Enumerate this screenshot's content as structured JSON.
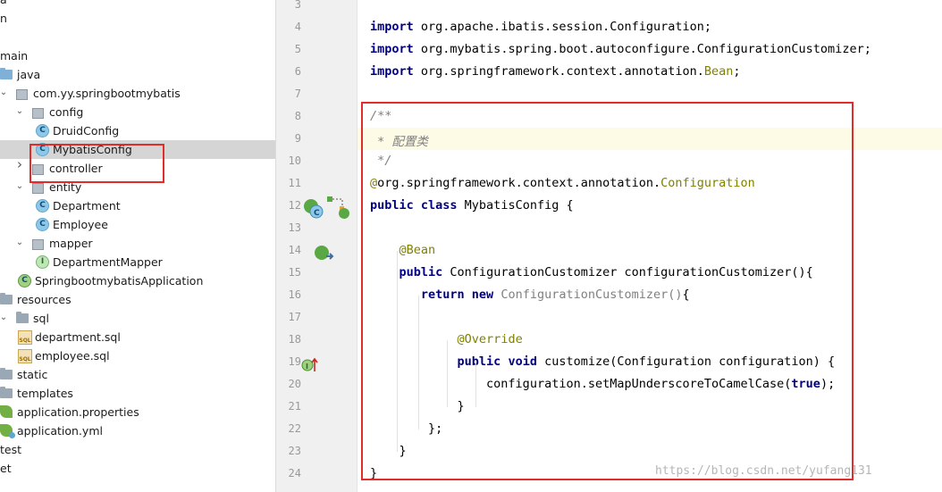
{
  "project_tree": {
    "items": [
      {
        "label": "a",
        "icon": "none",
        "arrow": "",
        "x": 0
      },
      {
        "label": "n",
        "icon": "none",
        "arrow": "",
        "x": 0
      },
      {
        "label": "",
        "icon": "none",
        "arrow": "",
        "x": 0
      },
      {
        "label": "main",
        "icon": "none",
        "arrow": "",
        "x": 0
      },
      {
        "label": "java",
        "icon": "folder-blue",
        "arrow": "",
        "x": 0
      },
      {
        "label": "com.yy.springbootmybatis",
        "icon": "package",
        "arrow": "down",
        "x": 0
      },
      {
        "label": "config",
        "icon": "package",
        "arrow": "down",
        "x": 18
      },
      {
        "label": "DruidConfig",
        "icon": "class",
        "arrow": "",
        "x": 40
      },
      {
        "label": "MybatisConfig",
        "icon": "class",
        "arrow": "",
        "x": 40,
        "selected": true
      },
      {
        "label": "controller",
        "icon": "package",
        "arrow": "right",
        "x": 18
      },
      {
        "label": "entity",
        "icon": "package",
        "arrow": "down",
        "x": 18
      },
      {
        "label": "Department",
        "icon": "class",
        "arrow": "",
        "x": 40
      },
      {
        "label": "Employee",
        "icon": "class",
        "arrow": "",
        "x": 40
      },
      {
        "label": "mapper",
        "icon": "package",
        "arrow": "down",
        "x": 18
      },
      {
        "label": "DepartmentMapper",
        "icon": "interface",
        "arrow": "",
        "x": 40
      },
      {
        "label": "SpringbootmybatisApplication",
        "icon": "spring-class",
        "arrow": "",
        "x": 20
      },
      {
        "label": "resources",
        "icon": "folder",
        "arrow": "",
        "x": 0
      },
      {
        "label": "sql",
        "icon": "folder",
        "arrow": "down",
        "x": 0
      },
      {
        "label": "department.sql",
        "icon": "sql-file",
        "arrow": "",
        "x": 20
      },
      {
        "label": "employee.sql",
        "icon": "sql-file",
        "arrow": "",
        "x": 20
      },
      {
        "label": "static",
        "icon": "folder",
        "arrow": "",
        "x": 0
      },
      {
        "label": "templates",
        "icon": "folder",
        "arrow": "",
        "x": 0
      },
      {
        "label": "application.properties",
        "icon": "spring-leaf",
        "arrow": "",
        "x": 0
      },
      {
        "label": "application.yml",
        "icon": "spring-leaf-app",
        "arrow": "",
        "x": 0
      },
      {
        "label": "test",
        "icon": "none",
        "arrow": "",
        "x": 0
      },
      {
        "label": "et",
        "icon": "none",
        "arrow": "",
        "x": 0
      }
    ]
  },
  "editor": {
    "first_line_number": 3,
    "current_line": 9,
    "lines": [
      {
        "n": "3",
        "tokens": []
      },
      {
        "n": "4",
        "tokens": [
          {
            "t": "import",
            "c": "kw"
          },
          {
            "t": " org.apache.ibatis.session.Configuration;",
            "c": ""
          }
        ]
      },
      {
        "n": "5",
        "tokens": [
          {
            "t": "import",
            "c": "kw"
          },
          {
            "t": " org.mybatis.spring.boot.autoconfigure.ConfigurationCustomizer;",
            "c": ""
          }
        ]
      },
      {
        "n": "6",
        "tokens": [
          {
            "t": "import",
            "c": "kw"
          },
          {
            "t": " org.springframework.context.annotation.",
            "c": ""
          },
          {
            "t": "Bean",
            "c": "an"
          },
          {
            "t": ";",
            "c": ""
          }
        ]
      },
      {
        "n": "7",
        "tokens": []
      },
      {
        "n": "8",
        "tokens": [
          {
            "t": "/**",
            "c": "cm"
          }
        ]
      },
      {
        "n": "9",
        "tokens": [
          {
            "t": " * 配置类",
            "c": "cm"
          }
        ]
      },
      {
        "n": "10",
        "tokens": [
          {
            "t": " */",
            "c": "cm"
          }
        ]
      },
      {
        "n": "11",
        "tokens": [
          {
            "t": "@",
            "c": "an"
          },
          {
            "t": "org.springframework.context.annotation.",
            "c": ""
          },
          {
            "t": "Configuration",
            "c": "an"
          }
        ]
      },
      {
        "n": "12",
        "tokens": [
          {
            "t": "public class",
            "c": "kw"
          },
          {
            "t": " MybatisConfig {",
            "c": ""
          }
        ]
      },
      {
        "n": "13",
        "tokens": []
      },
      {
        "n": "14",
        "tokens": [
          {
            "t": "    ",
            "c": ""
          },
          {
            "t": "@Bean",
            "c": "an"
          }
        ]
      },
      {
        "n": "15",
        "tokens": [
          {
            "t": "    ",
            "c": ""
          },
          {
            "t": "public",
            "c": "kw"
          },
          {
            "t": " ConfigurationCustomizer configurationCustomizer(){",
            "c": ""
          }
        ]
      },
      {
        "n": "16",
        "tokens": [
          {
            "t": "       ",
            "c": ""
          },
          {
            "t": "return new",
            "c": "kw"
          },
          {
            "t": " ConfigurationCustomizer()",
            "c": "tp"
          },
          {
            "t": "{",
            "c": ""
          }
        ]
      },
      {
        "n": "17",
        "tokens": []
      },
      {
        "n": "18",
        "tokens": [
          {
            "t": "            ",
            "c": ""
          },
          {
            "t": "@Override",
            "c": "an"
          }
        ]
      },
      {
        "n": "19",
        "tokens": [
          {
            "t": "            ",
            "c": ""
          },
          {
            "t": "public void",
            "c": "kw"
          },
          {
            "t": " customize(Configuration configuration) {",
            "c": ""
          }
        ]
      },
      {
        "n": "20",
        "tokens": [
          {
            "t": "                ",
            "c": ""
          },
          {
            "t": "configuration.setMapUnderscoreToCamelCase(",
            "c": ""
          },
          {
            "t": "true",
            "c": "kw"
          },
          {
            "t": ");",
            "c": ""
          }
        ]
      },
      {
        "n": "21",
        "tokens": [
          {
            "t": "            }",
            "c": ""
          }
        ]
      },
      {
        "n": "22",
        "tokens": [
          {
            "t": "        };",
            "c": ""
          }
        ]
      },
      {
        "n": "23",
        "tokens": [
          {
            "t": "    }",
            "c": ""
          }
        ]
      },
      {
        "n": "24",
        "tokens": [
          {
            "t": "}",
            "c": ""
          }
        ]
      }
    ]
  },
  "gutter_icons": {
    "line_12": [
      "spring-bean-class-icon",
      "spring-config-icon"
    ],
    "line_14": [
      "spring-bean-method-icon"
    ],
    "line_19": [
      "implements-method-icon"
    ]
  },
  "watermark": "https://blog.csdn.net/yufang131"
}
